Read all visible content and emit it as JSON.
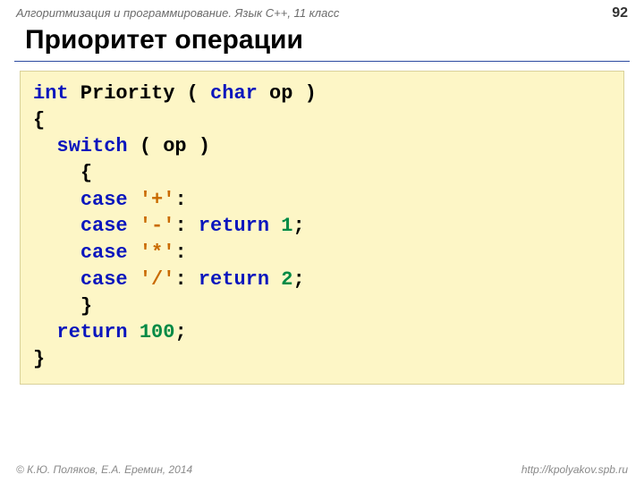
{
  "header": {
    "breadcrumb": "Алгоритмизация и программирование. Язык C++, 11 класс",
    "page_number": "92"
  },
  "title": "Приоритет операции",
  "code": {
    "kw_int": "int",
    "fn_name": " Priority ( ",
    "kw_char": "char",
    "fn_tail": " op )",
    "open_brace": "{",
    "indent1": "  ",
    "kw_switch": "switch",
    "switch_tail": " ( op )",
    "indent2": "    ",
    "inner_open": "{",
    "kw_case1": "case ",
    "lit_plus": "'+'",
    "colon": ":",
    "kw_case2": "case ",
    "lit_minus": "'-'",
    "colon2": ": ",
    "kw_return1": "return",
    "sp1": " ",
    "num1": "1",
    "semi1": ";",
    "kw_case3": "case ",
    "lit_star": "'*'",
    "colon3": ":",
    "kw_case4": "case ",
    "lit_slash": "'/'",
    "colon4": ": ",
    "kw_return2": "return",
    "sp2": " ",
    "num2": "2",
    "semi2": ";",
    "inner_close": "}",
    "kw_return3": "return",
    "sp3": " ",
    "num100": "100",
    "semi3": ";",
    "close_brace": "}"
  },
  "footer": {
    "copyright": "© К.Ю. Поляков, Е.А. Еремин, 2014",
    "url": "http://kpolyakov.spb.ru"
  }
}
